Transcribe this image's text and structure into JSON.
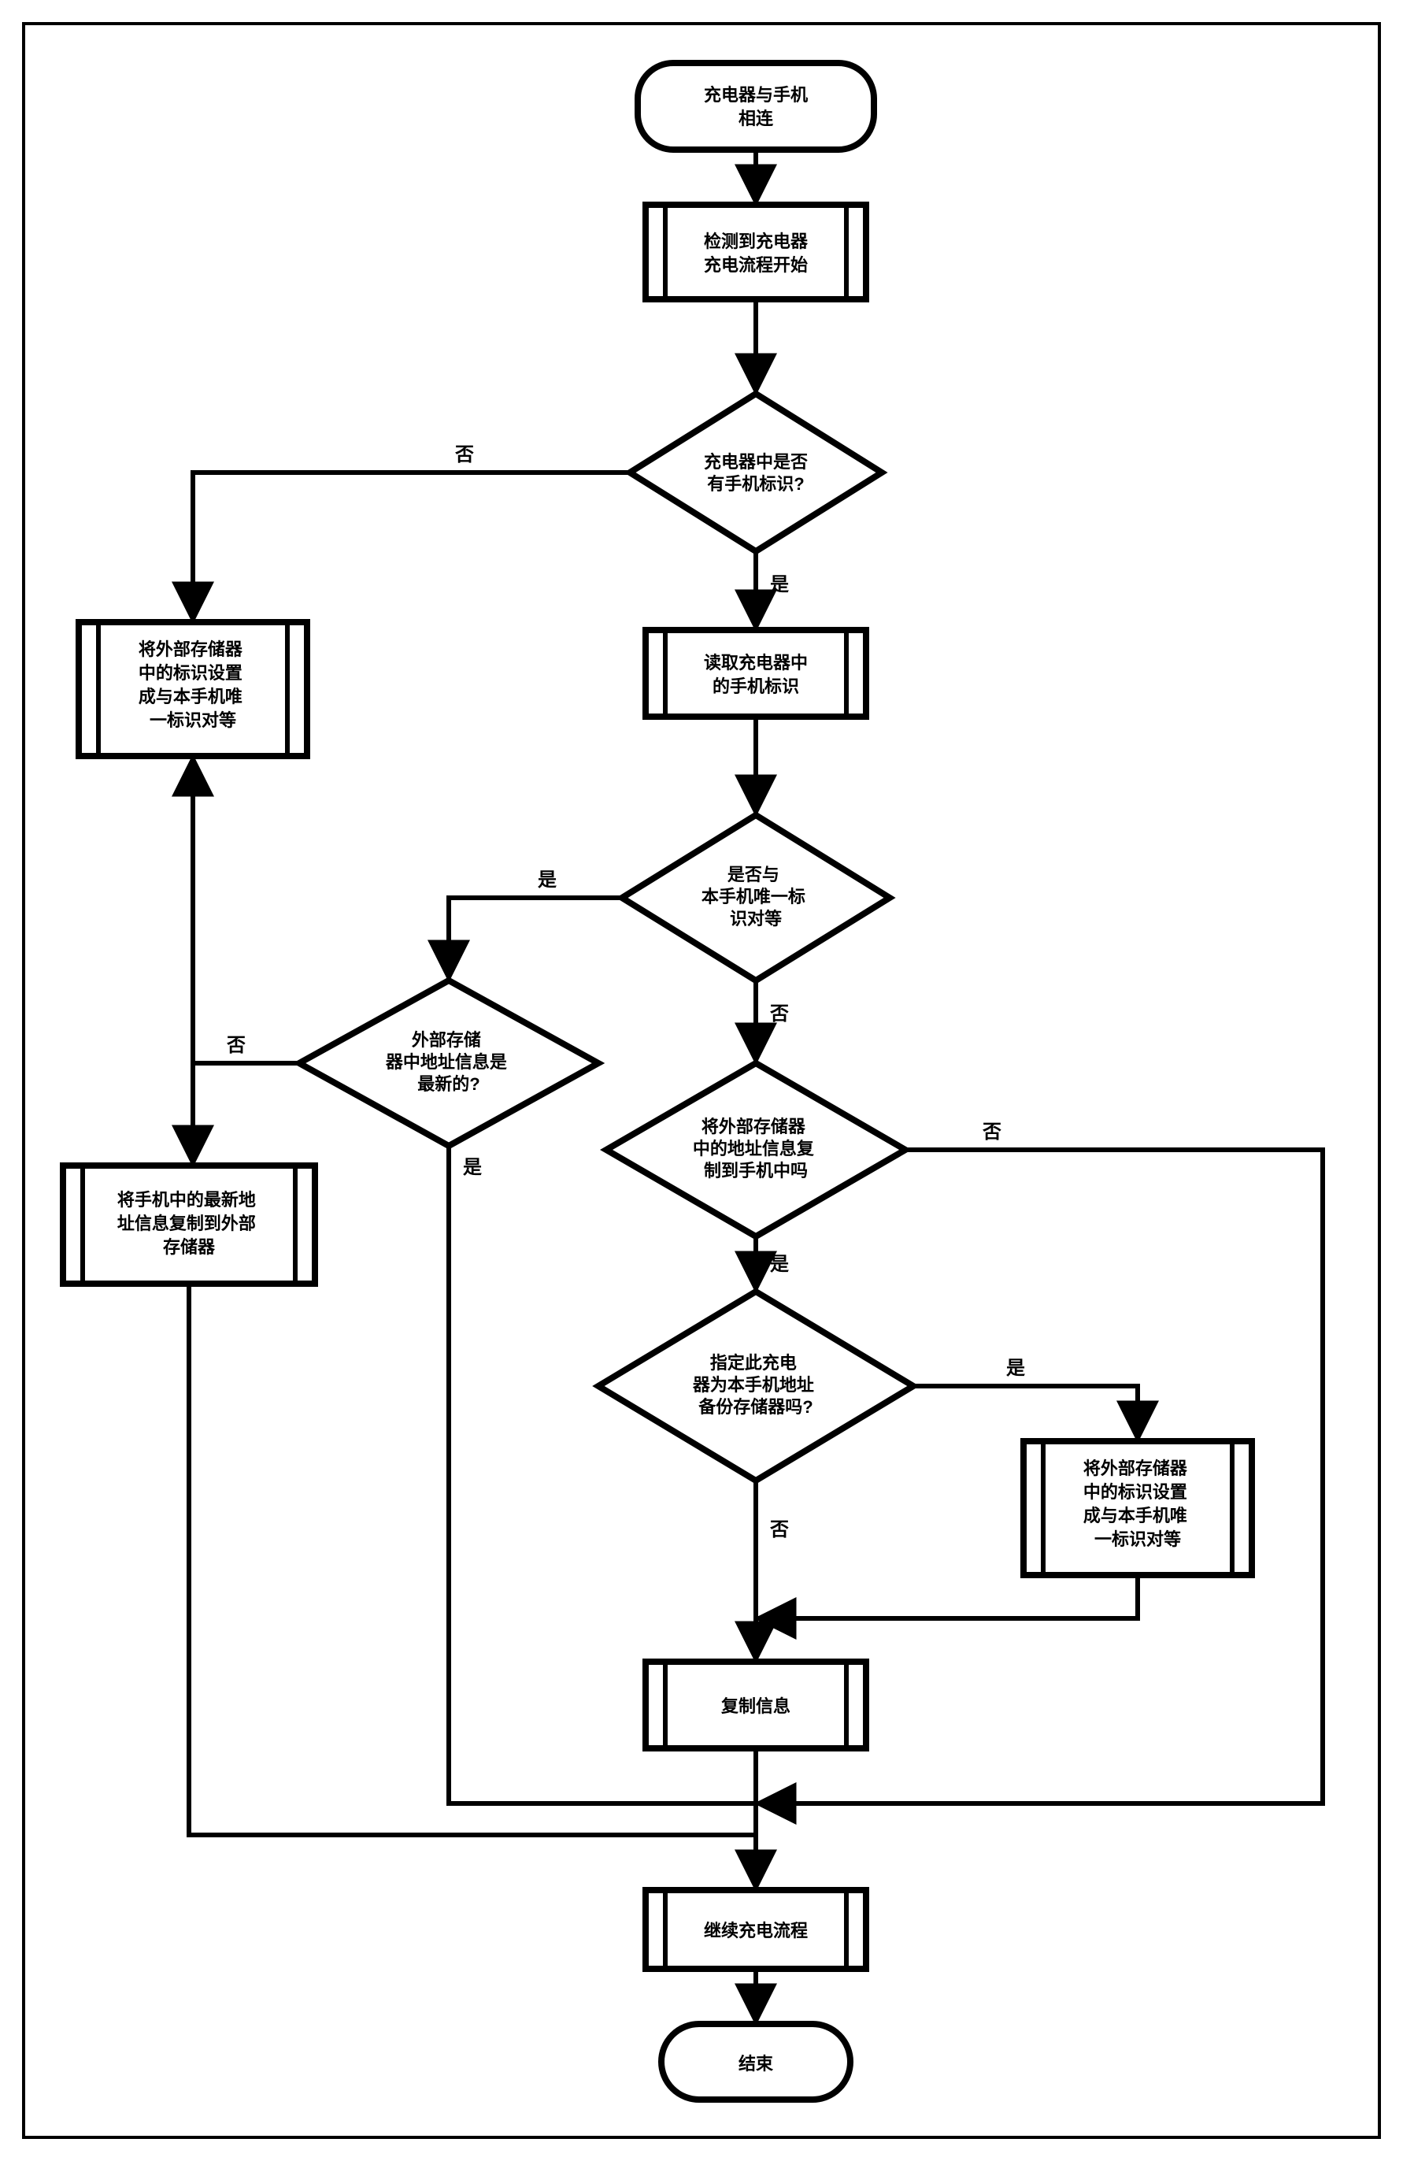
{
  "chart_data": {
    "type": "flowchart",
    "nodes": [
      {
        "id": "start",
        "shape": "terminator",
        "text": [
          "充电器与手机",
          "相连"
        ]
      },
      {
        "id": "p_detect",
        "shape": "process",
        "text": [
          "检测到充电器",
          "充电流程开始"
        ]
      },
      {
        "id": "d_hasid",
        "shape": "decision",
        "text": [
          "充电器中是否",
          "有手机标识?"
        ]
      },
      {
        "id": "p_setid_left",
        "shape": "process",
        "text": [
          "将外部存储器",
          "中的标识设置",
          "成与本手机唯",
          "一标识对等"
        ]
      },
      {
        "id": "p_readid",
        "shape": "process",
        "text": [
          "读取充电器中",
          "的手机标识"
        ]
      },
      {
        "id": "d_match",
        "shape": "decision",
        "text": [
          "是否与",
          "本手机唯一标",
          "识对等"
        ]
      },
      {
        "id": "d_latest",
        "shape": "decision",
        "text": [
          "外部存储",
          "器中地址信息是",
          "最新的?"
        ]
      },
      {
        "id": "p_copy_to_ext",
        "shape": "process",
        "text": [
          "将手机中的最新地",
          "址信息复制到外部",
          "存储器"
        ]
      },
      {
        "id": "d_copy_q",
        "shape": "decision",
        "text": [
          "将外部存储器",
          "中的地址信息复",
          "制到手机中吗"
        ]
      },
      {
        "id": "d_assign",
        "shape": "decision",
        "text": [
          "指定此充电",
          "器为本手机地址",
          "备份存储器吗?"
        ]
      },
      {
        "id": "p_setid_right",
        "shape": "process",
        "text": [
          "将外部存储器",
          "中的标识设置",
          "成与本手机唯",
          "一标识对等"
        ]
      },
      {
        "id": "p_copyinfo",
        "shape": "process",
        "text": [
          "复制信息"
        ]
      },
      {
        "id": "p_continue",
        "shape": "process",
        "text": [
          "继续充电流程"
        ]
      },
      {
        "id": "end",
        "shape": "terminator",
        "text": [
          "结束"
        ]
      }
    ],
    "edges": [
      {
        "from": "start",
        "to": "p_detect"
      },
      {
        "from": "p_detect",
        "to": "d_hasid"
      },
      {
        "from": "d_hasid",
        "to": "p_setid_left",
        "label": "否"
      },
      {
        "from": "d_hasid",
        "to": "p_readid",
        "label": "是"
      },
      {
        "from": "p_setid_left",
        "to": "p_copy_to_ext"
      },
      {
        "from": "p_readid",
        "to": "d_match"
      },
      {
        "from": "d_match",
        "to": "d_latest",
        "label": "是"
      },
      {
        "from": "d_match",
        "to": "d_copy_q",
        "label": "否"
      },
      {
        "from": "d_latest",
        "to": "p_setid_left",
        "label": "否"
      },
      {
        "from": "d_latest",
        "to": "p_continue",
        "label": "是"
      },
      {
        "from": "d_copy_q",
        "to": "d_assign",
        "label": "是"
      },
      {
        "from": "d_copy_q",
        "to": "p_continue",
        "label": "否"
      },
      {
        "from": "d_assign",
        "to": "p_setid_right",
        "label": "是"
      },
      {
        "from": "d_assign",
        "to": "p_copyinfo",
        "label": "否"
      },
      {
        "from": "p_setid_right",
        "to": "p_copyinfo"
      },
      {
        "from": "p_copyinfo",
        "to": "p_continue"
      },
      {
        "from": "p_copy_to_ext",
        "to": "p_continue"
      },
      {
        "from": "p_continue",
        "to": "end"
      }
    ],
    "edge_labels": {
      "yes": "是",
      "no": "否"
    }
  }
}
